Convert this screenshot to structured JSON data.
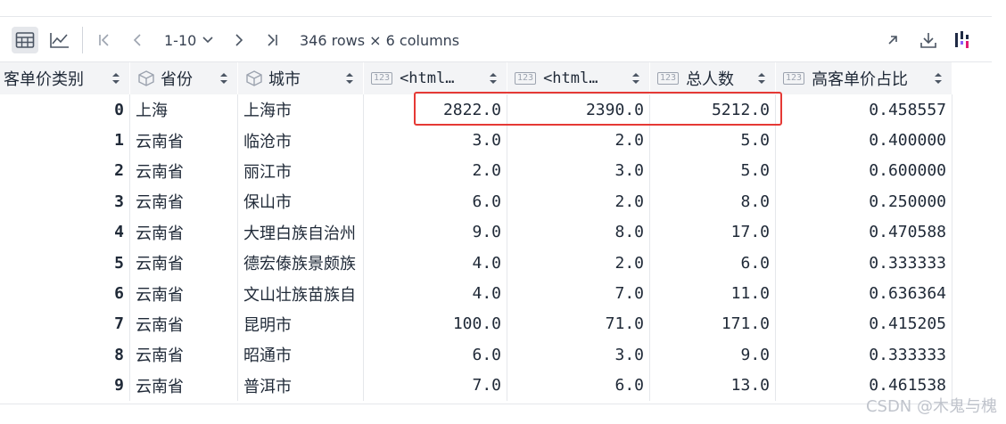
{
  "toolbar": {
    "page_range": "1-10",
    "rows_info": "346 rows × 6 columns"
  },
  "columns": [
    {
      "label": "客单价类别",
      "type_icon": "none"
    },
    {
      "label": "省份",
      "type_icon": "cube-icon"
    },
    {
      "label": "城市",
      "type_icon": "cube-icon"
    },
    {
      "label": "<html…",
      "type_icon": "numeric-123-icon"
    },
    {
      "label": "<html…",
      "type_icon": "numeric-123-icon"
    },
    {
      "label": "总人数",
      "type_icon": "numeric-123-icon"
    },
    {
      "label": "高客单价占比",
      "type_icon": "numeric-123-icon"
    }
  ],
  "rows": [
    {
      "idx": "0",
      "province": "上海",
      "city": "上海市",
      "c1": "2822.0",
      "c2": "2390.0",
      "total": "5212.0",
      "ratio": "0.458557"
    },
    {
      "idx": "1",
      "province": "云南省",
      "city": "临沧市",
      "c1": "3.0",
      "c2": "2.0",
      "total": "5.0",
      "ratio": "0.400000"
    },
    {
      "idx": "2",
      "province": "云南省",
      "city": "丽江市",
      "c1": "2.0",
      "c2": "3.0",
      "total": "5.0",
      "ratio": "0.600000"
    },
    {
      "idx": "3",
      "province": "云南省",
      "city": "保山市",
      "c1": "6.0",
      "c2": "2.0",
      "total": "8.0",
      "ratio": "0.250000"
    },
    {
      "idx": "4",
      "province": "云南省",
      "city": "大理白族自治州",
      "c1": "9.0",
      "c2": "8.0",
      "total": "17.0",
      "ratio": "0.470588"
    },
    {
      "idx": "5",
      "province": "云南省",
      "city": "德宏傣族景颇族",
      "c1": "4.0",
      "c2": "2.0",
      "total": "6.0",
      "ratio": "0.333333"
    },
    {
      "idx": "6",
      "province": "云南省",
      "city": "文山壮族苗族自",
      "c1": "4.0",
      "c2": "7.0",
      "total": "11.0",
      "ratio": "0.636364"
    },
    {
      "idx": "7",
      "province": "云南省",
      "city": "昆明市",
      "c1": "100.0",
      "c2": "71.0",
      "total": "171.0",
      "ratio": "0.415205"
    },
    {
      "idx": "8",
      "province": "云南省",
      "city": "昭通市",
      "c1": "6.0",
      "c2": "3.0",
      "total": "9.0",
      "ratio": "0.333333"
    },
    {
      "idx": "9",
      "province": "云南省",
      "city": "普洱市",
      "c1": "7.0",
      "c2": "6.0",
      "total": "13.0",
      "ratio": "0.461538"
    }
  ],
  "watermark": "CSDN @木鬼与槐",
  "colors": {
    "highlight": "#e53935",
    "header_bg": "#f3f4f6",
    "active_button_bg": "#e5e7eb"
  }
}
